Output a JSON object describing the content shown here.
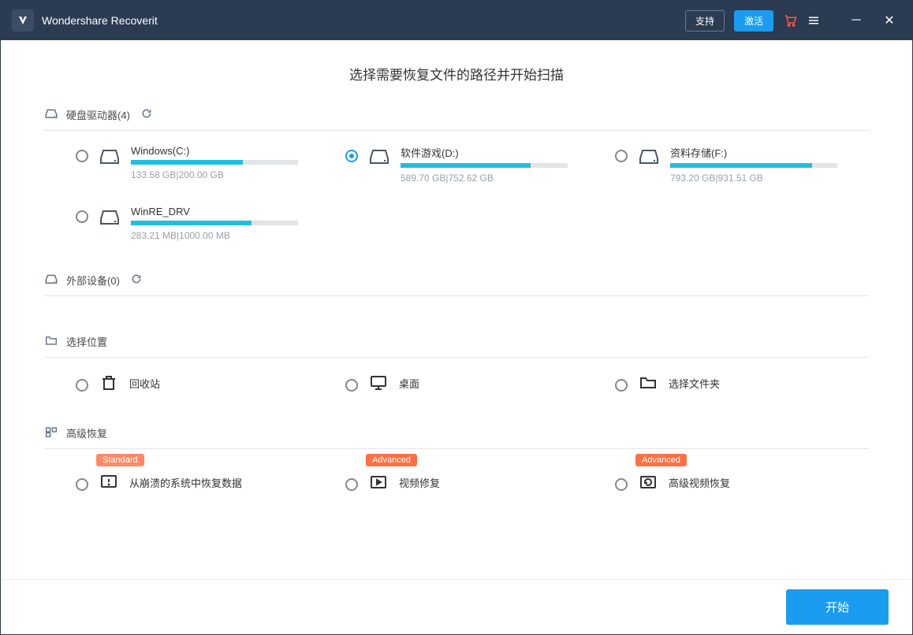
{
  "app_title": "Wondershare Recoverit",
  "header_buttons": {
    "support": "支持",
    "activate": "激活"
  },
  "page_title": "选择需要恢复文件的路径并开始扫描",
  "sections": {
    "hdd": {
      "label": "硬盘驱动器",
      "count": 4
    },
    "external": {
      "label": "外部设备",
      "count": 0
    },
    "locations": {
      "label": "选择位置"
    },
    "advanced": {
      "label": "高级恢复"
    }
  },
  "drives": [
    {
      "label": "Windows(C:)",
      "used": "133.58 GB",
      "total": "200.00 GB",
      "percent": 67,
      "selected": false
    },
    {
      "label": "软件游戏(D:)",
      "used": "589.70 GB",
      "total": "752.62 GB",
      "percent": 78,
      "selected": true
    },
    {
      "label": "资料存储(F:)",
      "used": "793.20 GB",
      "total": "931.51 GB",
      "percent": 85,
      "selected": false
    },
    {
      "label": "WinRE_DRV",
      "used": "283.21 MB",
      "total": "1000.00 MB",
      "percent": 72,
      "selected": false
    }
  ],
  "locations": [
    {
      "id": "recycle-bin",
      "label": "回收站"
    },
    {
      "id": "desktop",
      "label": "桌面"
    },
    {
      "id": "choose-folder",
      "label": "选择文件夹"
    }
  ],
  "advanced_items": [
    {
      "id": "crash-recover",
      "label": "从崩溃的系统中恢复数据",
      "badge": "Standard"
    },
    {
      "id": "video-repair",
      "label": "视频修复",
      "badge": "Advanced"
    },
    {
      "id": "adv-video-recover",
      "label": "高级视频恢复",
      "badge": "Advanced"
    }
  ],
  "footer": {
    "start": "开始"
  }
}
